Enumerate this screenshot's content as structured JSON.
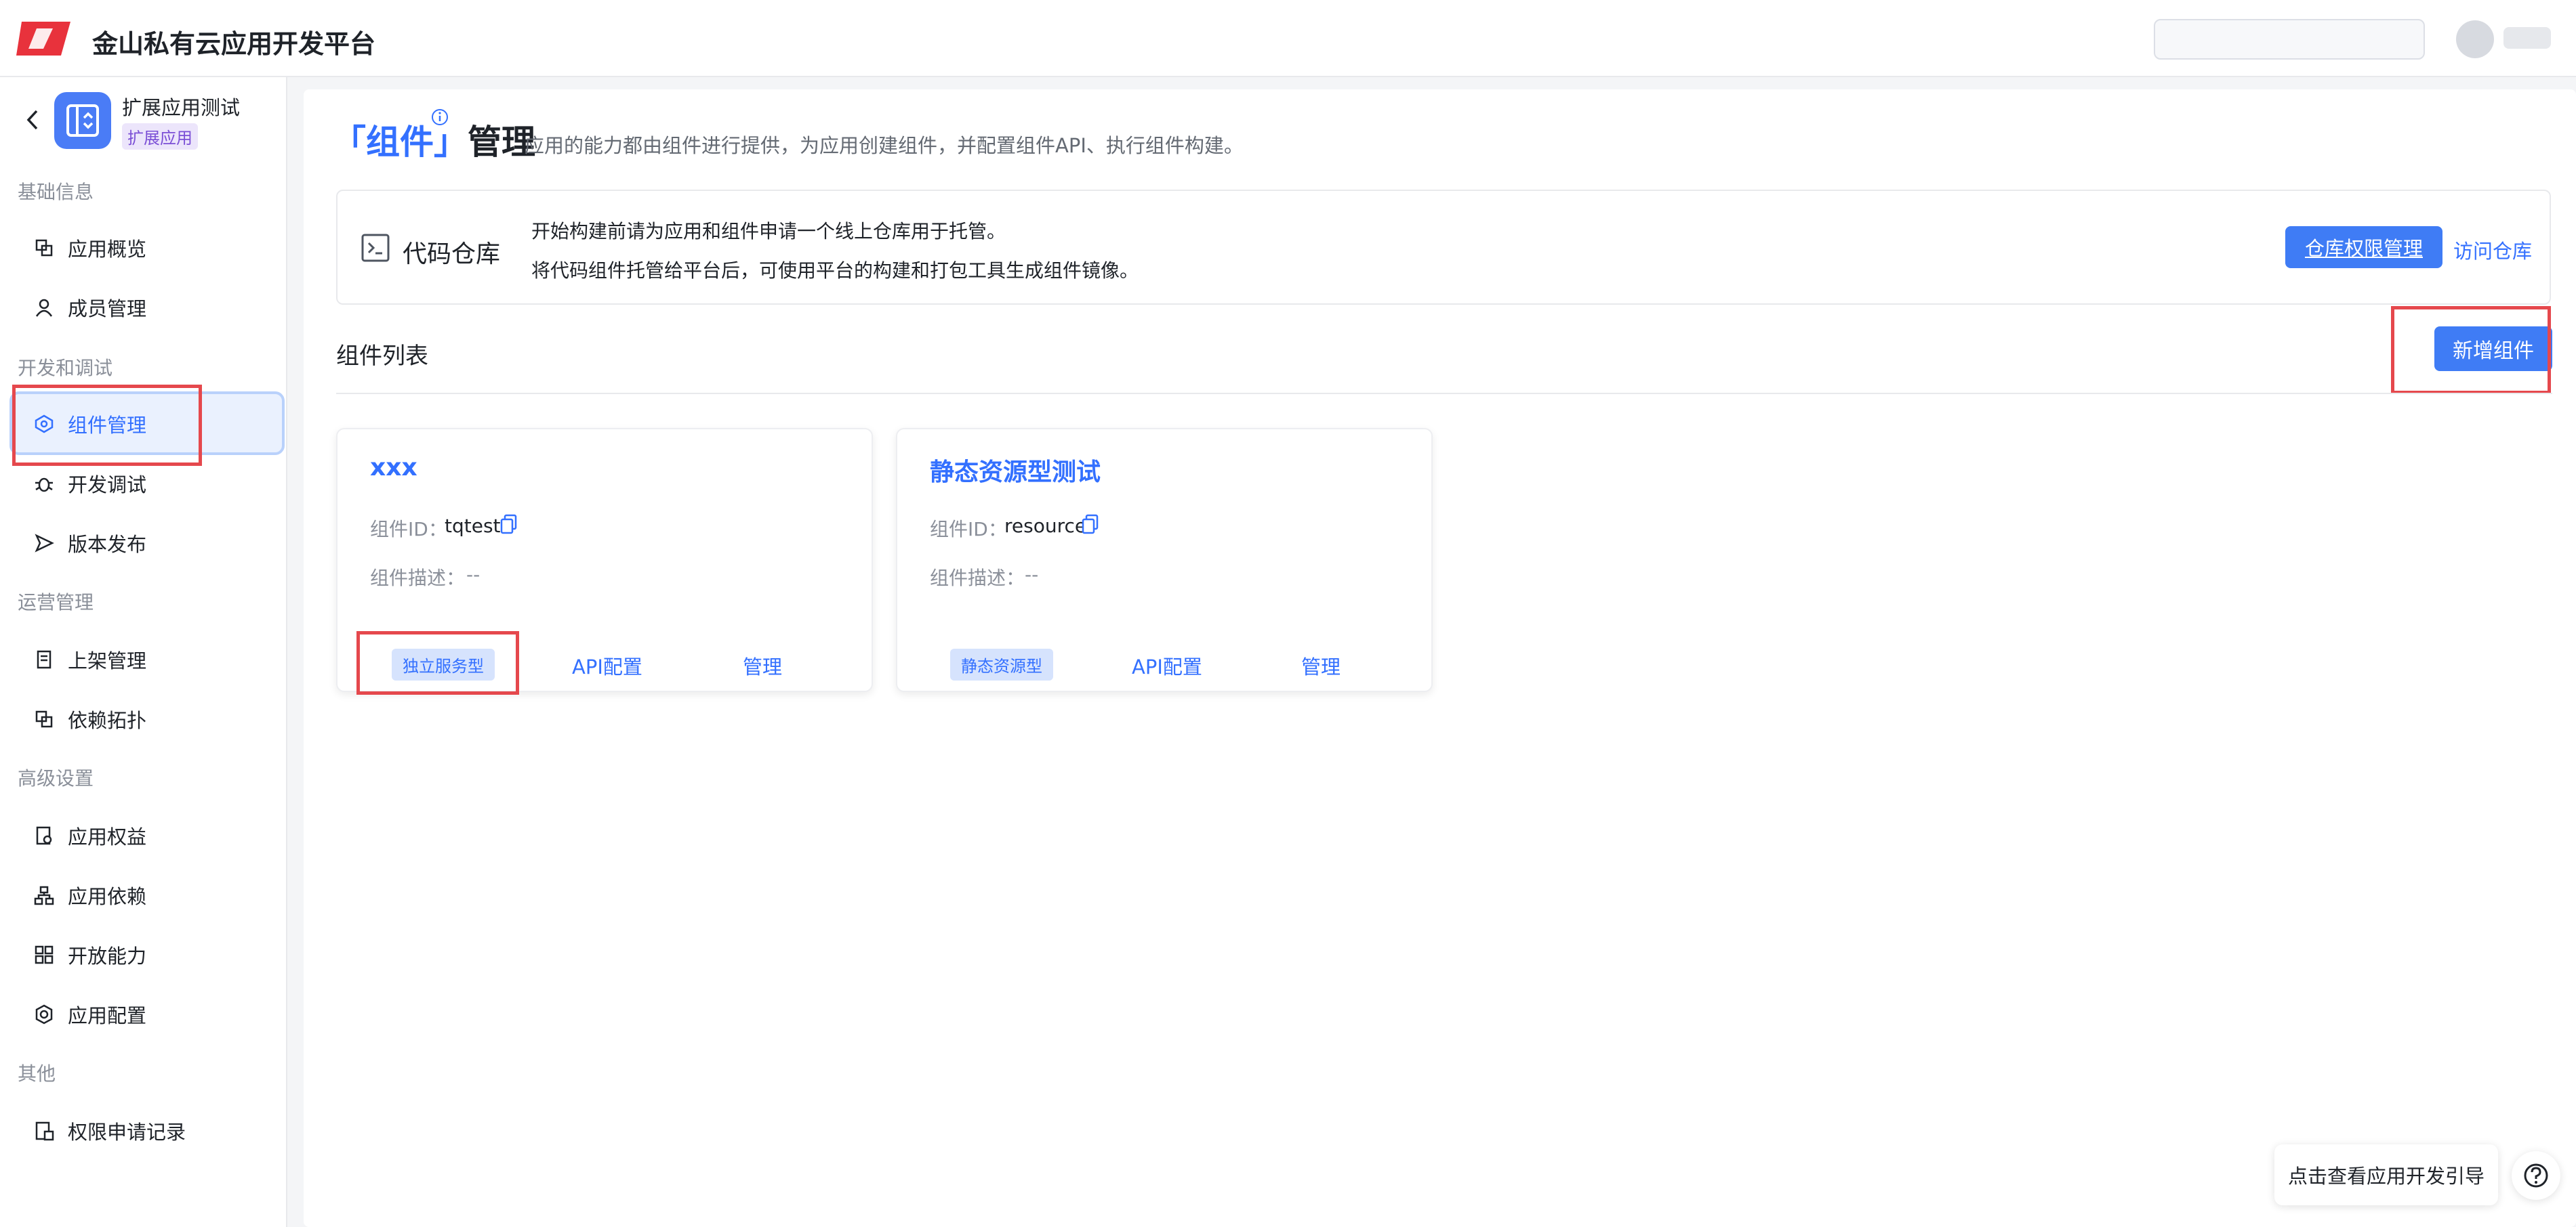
{
  "header": {
    "title": "金山私有云应用开发平台",
    "search_placeholder": "",
    "user_name": ""
  },
  "app": {
    "name": "扩展应用测试",
    "tag": "扩展应用"
  },
  "sidebar": {
    "groups": [
      {
        "label": "基础信息",
        "items": [
          {
            "label": "应用概览",
            "icon": "overview-icon"
          },
          {
            "label": "成员管理",
            "icon": "user-icon"
          }
        ]
      },
      {
        "label": "开发和调试",
        "items": [
          {
            "label": "组件管理",
            "icon": "component-icon",
            "active": true
          },
          {
            "label": "开发调试",
            "icon": "bug-icon"
          },
          {
            "label": "版本发布",
            "icon": "send-icon"
          }
        ]
      },
      {
        "label": "运营管理",
        "items": [
          {
            "label": "上架管理",
            "icon": "listing-icon"
          },
          {
            "label": "依赖拓扑",
            "icon": "topology-icon"
          }
        ]
      },
      {
        "label": "高级设置",
        "items": [
          {
            "label": "应用权益",
            "icon": "rights-icon"
          },
          {
            "label": "应用依赖",
            "icon": "dependency-icon"
          },
          {
            "label": "开放能力",
            "icon": "grid-icon"
          },
          {
            "label": "应用配置",
            "icon": "gear-icon"
          }
        ]
      },
      {
        "label": "其他",
        "items": [
          {
            "label": "权限申请记录",
            "icon": "record-icon"
          }
        ]
      }
    ]
  },
  "page": {
    "title_open": "「",
    "title_word": "组件",
    "title_close": "」",
    "title_rest": "管理",
    "description": "应用的能力都由组件进行提供，为应用创建组件，并配置组件API、执行组件构建。"
  },
  "repo": {
    "title": "代码仓库",
    "line1": "开始构建前请为应用和组件申请一个线上仓库用于托管。",
    "line2": "将代码组件托管给平台后，可使用平台的构建和打包工具生成组件镜像。",
    "perm_button": "仓库权限管理",
    "visit_link": "访问仓库"
  },
  "component_list": {
    "title": "组件列表",
    "add_button": "新增组件",
    "id_label": "组件ID：",
    "desc_label": "组件描述：",
    "items": [
      {
        "name": "xxx",
        "id": "tqtest",
        "desc": "--",
        "tag": "独立服务型",
        "api_link": "API配置",
        "manage_link": "管理"
      },
      {
        "name": "静态资源型测试",
        "id": "resource",
        "desc": "--",
        "tag": "静态资源型",
        "api_link": "API配置",
        "manage_link": "管理"
      }
    ]
  },
  "help": {
    "guide_text": "点击查看应用开发引导"
  },
  "colors": {
    "primary": "#3370ff",
    "highlight": "#e5484d",
    "logo": "#e8323c"
  }
}
